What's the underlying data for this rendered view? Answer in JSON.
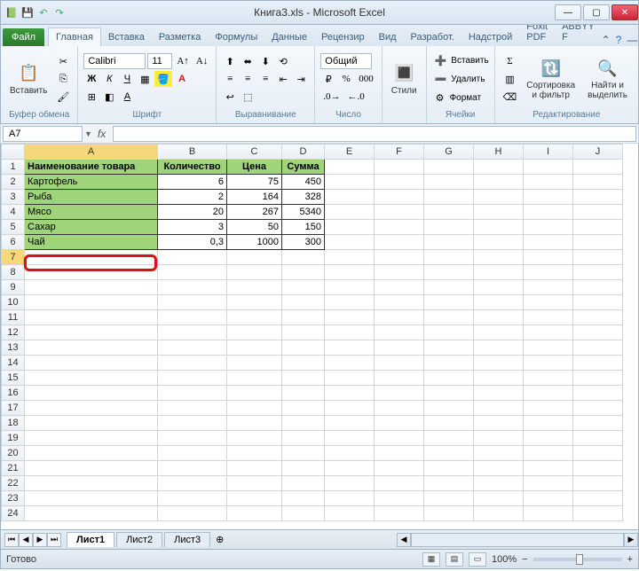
{
  "title": "Книга3.xls - Microsoft Excel",
  "ribbon_tabs": {
    "file": "Файл",
    "tabs": [
      "Главная",
      "Вставка",
      "Разметка",
      "Формулы",
      "Данные",
      "Рецензир",
      "Вид",
      "Разработ.",
      "Надстрой",
      "Foxit PDF",
      "ABBYY F"
    ],
    "active": "Главная"
  },
  "ribbon": {
    "clipboard": {
      "paste": "Вставить",
      "label": "Буфер обмена"
    },
    "font": {
      "name": "Calibri",
      "size": "11",
      "label": "Шрифт"
    },
    "align": {
      "label": "Выравнивание"
    },
    "number": {
      "format": "Общий",
      "label": "Число"
    },
    "styles": {
      "btn": "Стили"
    },
    "cells": {
      "insert": "Вставить",
      "delete": "Удалить",
      "format": "Формат",
      "label": "Ячейки"
    },
    "editing": {
      "sort": "Сортировка и фильтр",
      "find": "Найти и выделить",
      "label": "Редактирование"
    }
  },
  "formula_bar": {
    "name_box": "A7",
    "fx": "fx",
    "value": ""
  },
  "columns": [
    "A",
    "B",
    "C",
    "D",
    "E",
    "F",
    "G",
    "H",
    "I",
    "J"
  ],
  "headers": [
    "Наименование товара",
    "Количество",
    "Цена",
    "Сумма"
  ],
  "rows": [
    {
      "name": "Картофель",
      "qty": "6",
      "price": "75",
      "sum": "450"
    },
    {
      "name": "Рыба",
      "qty": "2",
      "price": "164",
      "sum": "328"
    },
    {
      "name": "Мясо",
      "qty": "20",
      "price": "267",
      "sum": "5340"
    },
    {
      "name": "Сахар",
      "qty": "3",
      "price": "50",
      "sum": "150"
    },
    {
      "name": "Чай",
      "qty": "0,3",
      "price": "1000",
      "sum": "300"
    }
  ],
  "chart_data": {
    "type": "table",
    "columns": [
      "Наименование товара",
      "Количество",
      "Цена",
      "Сумма"
    ],
    "data": [
      [
        "Картофель",
        6,
        75,
        450
      ],
      [
        "Рыба",
        2,
        164,
        328
      ],
      [
        "Мясо",
        20,
        267,
        5340
      ],
      [
        "Сахар",
        3,
        50,
        150
      ],
      [
        "Чай",
        0.3,
        1000,
        300
      ]
    ]
  },
  "sheets": [
    "Лист1",
    "Лист2",
    "Лист3"
  ],
  "status": {
    "ready": "Готово",
    "zoom": "100%"
  }
}
